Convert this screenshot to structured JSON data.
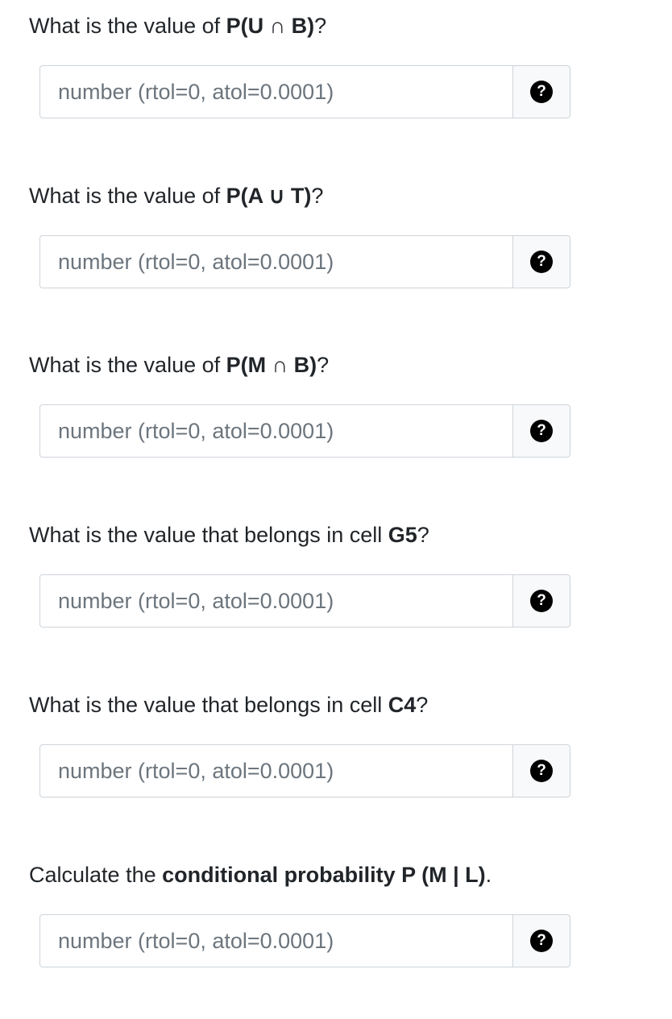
{
  "questions": [
    {
      "prompt_before": "What is the value of ",
      "prompt_bold": "P(U ∩ B)",
      "prompt_after": "?",
      "input_placeholder": "number (rtol=0, atol=0.0001)",
      "help_glyph": "?"
    },
    {
      "prompt_before": "What is the value of ",
      "prompt_bold": "P(A ∪ T)",
      "prompt_after": "?",
      "input_placeholder": "number (rtol=0, atol=0.0001)",
      "help_glyph": "?"
    },
    {
      "prompt_before": "What is the value of ",
      "prompt_bold": "P(M ∩ B)",
      "prompt_after": "?",
      "input_placeholder": "number (rtol=0, atol=0.0001)",
      "help_glyph": "?"
    },
    {
      "prompt_before": "What is the value that belongs in cell ",
      "prompt_bold": "G5",
      "prompt_after": "?",
      "input_placeholder": "number (rtol=0, atol=0.0001)",
      "help_glyph": "?"
    },
    {
      "prompt_before": "What is the value that belongs in cell ",
      "prompt_bold": "C4",
      "prompt_after": "?",
      "input_placeholder": "number (rtol=0, atol=0.0001)",
      "help_glyph": "?"
    },
    {
      "prompt_before": "Calculate the ",
      "prompt_bold": "conditional probability P (M | L)",
      "prompt_after": ".",
      "input_placeholder": "number (rtol=0, atol=0.0001)",
      "help_glyph": "?"
    }
  ],
  "colors": {
    "text": "#212529",
    "placeholder": "#6c757d",
    "border": "#ced4da",
    "addon_background": "#f8f9fa",
    "help_icon": "#000000"
  },
  "icons": {
    "help": "question-circle-icon"
  }
}
